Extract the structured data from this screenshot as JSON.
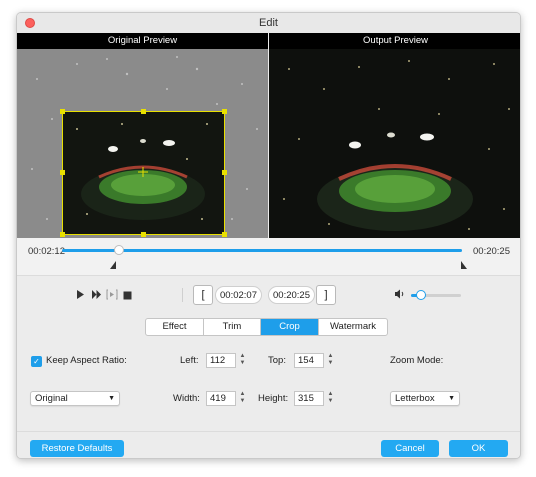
{
  "window": {
    "title": "Edit"
  },
  "preview": {
    "original_label": "Original Preview",
    "output_label": "Output Preview"
  },
  "timeline": {
    "current_time": "00:02:12",
    "end_time": "00:20:25",
    "progress": 0.11
  },
  "controls": {
    "play_icon": "play-icon",
    "next_frame_icon": "fast-forward-icon",
    "loop_icon": "loop-bracket-icon",
    "stop_icon": "stop-icon",
    "trim_start_label": "[",
    "trim_start_time": "00:02:07",
    "trim_end_time": "00:20:25",
    "trim_end_label": "]",
    "volume_icon": "speaker-icon",
    "volume_level": 0.2
  },
  "tabs": [
    {
      "label": "Effect",
      "active": false
    },
    {
      "label": "Trim",
      "active": false
    },
    {
      "label": "Crop",
      "active": true
    },
    {
      "label": "Watermark",
      "active": false
    }
  ],
  "crop": {
    "keep_aspect_label": "Keep Aspect Ratio:",
    "keep_aspect_checked": true,
    "aspect_select": "Original",
    "left_label": "Left:",
    "left_value": "112",
    "top_label": "Top:",
    "top_value": "154",
    "width_label": "Width:",
    "width_value": "419",
    "height_label": "Height:",
    "height_value": "315",
    "zoom_mode_label": "Zoom Mode:",
    "zoom_mode_select": "Letterbox"
  },
  "footer": {
    "restore_label": "Restore Defaults",
    "cancel_label": "Cancel",
    "ok_label": "OK"
  },
  "colors": {
    "accent": "#1e9eea",
    "crop_frame": "#e8e000",
    "close_button": "#fc605c"
  }
}
